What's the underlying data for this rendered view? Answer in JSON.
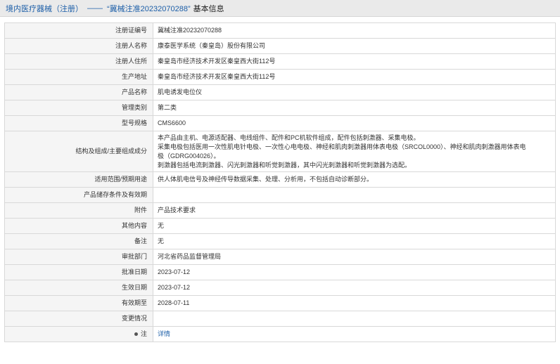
{
  "header": {
    "category": "境内医疗器械（注册）",
    "separator": "——",
    "cert_quoted": "“冀械注准20232070288”",
    "suffix": "基本信息"
  },
  "rows": [
    {
      "label": "注册证编号",
      "value": "冀械注准20232070288"
    },
    {
      "label": "注册人名称",
      "value": "康泰医学系统（秦皇岛）股份有限公司"
    },
    {
      "label": "注册人住所",
      "value": "秦皇岛市经济技术开发区秦皇西大街112号"
    },
    {
      "label": "生产地址",
      "value": "秦皇岛市经济技术开发区秦皇西大街112号"
    },
    {
      "label": "产品名称",
      "value": "肌电诱发电位仪"
    },
    {
      "label": "管理类别",
      "value": "第二类"
    },
    {
      "label": "型号规格",
      "value": "CMS6600"
    },
    {
      "label": "结构及组成/主要组成成分",
      "lines": [
        "本产品由主机、电源适配器、电线组件、配件和PC机软件组成，配件包括刺激器、采集电极。",
        "采集电极包括医用一次性肌电针电极、一次性心电电极、神经和肌肉刺激器用体表电极（SRCOL0000）、神经和肌肉刺激器用体表电",
        "极（GDRG004026）。",
        "刺激器包括电流刺激器、闪光刺激器和听觉刺激器，其中闪光刺激器和听觉刺激器为选配。"
      ]
    },
    {
      "label": "适用范围/预期用途",
      "value": "供人体肌电信号及神经传导数据采集、处理、分析用，不包括自动诊断部分。"
    },
    {
      "label": "产品储存条件及有效期",
      "value": ""
    },
    {
      "label": "附件",
      "value": "产品技术要求"
    },
    {
      "label": "其他内容",
      "value": "无"
    },
    {
      "label": "备注",
      "value": "无"
    },
    {
      "label": "审批部门",
      "value": "河北省药品监督管理局"
    },
    {
      "label": "批准日期",
      "value": "2023-07-12"
    },
    {
      "label": "生效日期",
      "value": "2023-07-12"
    },
    {
      "label": "有效期至",
      "value": "2028-07-11"
    },
    {
      "label": "变更情况",
      "value": ""
    },
    {
      "label": "注",
      "value": "详情"
    }
  ]
}
